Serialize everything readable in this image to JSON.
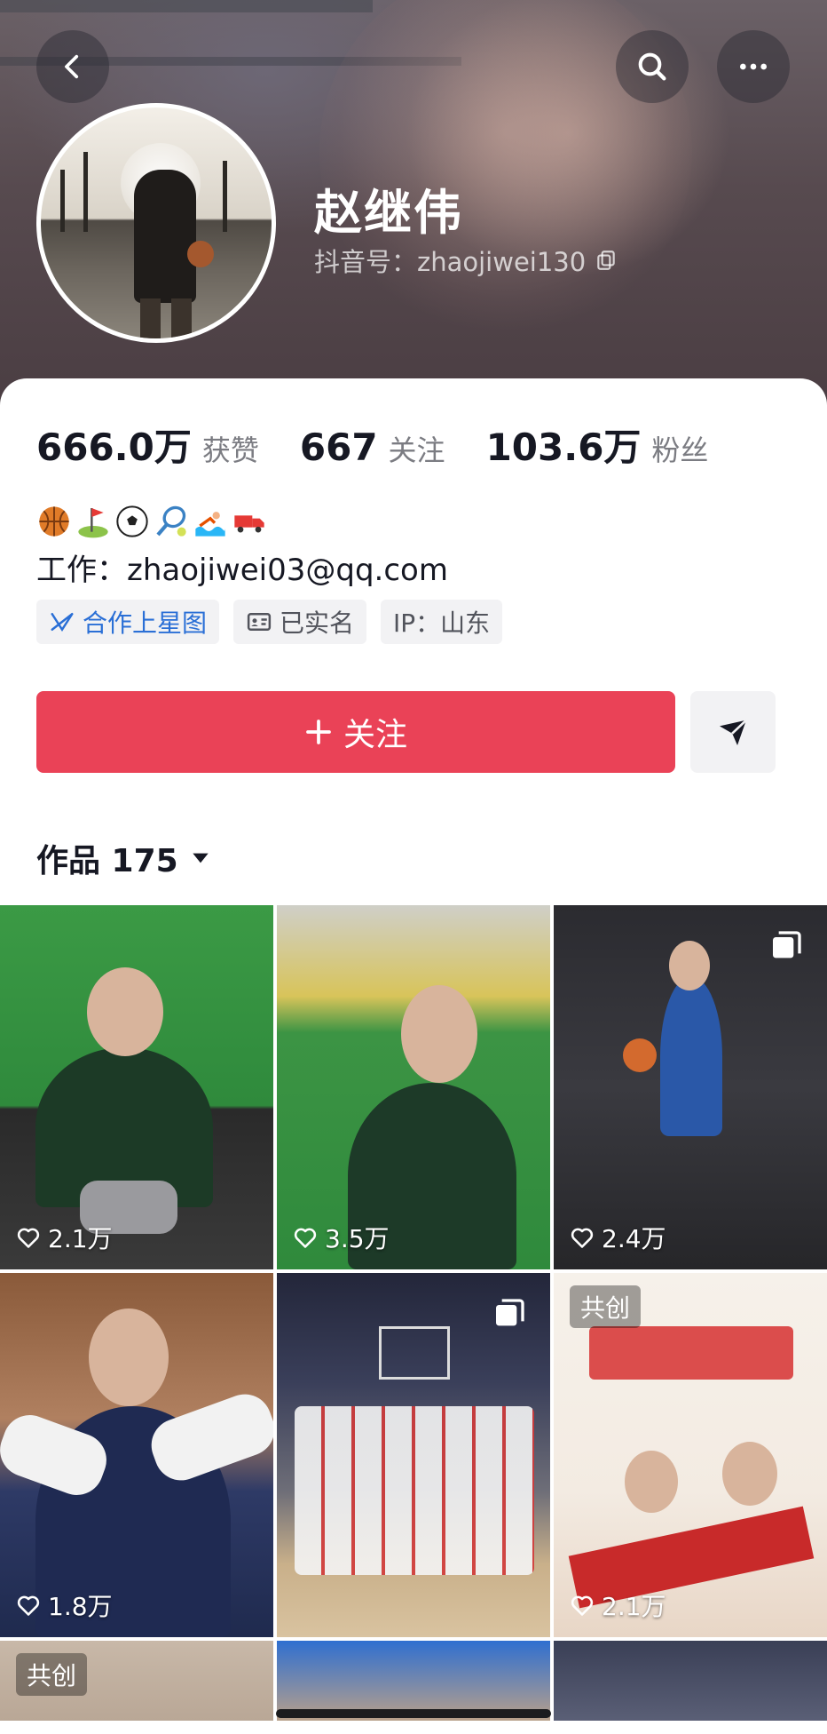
{
  "profile": {
    "name": "赵继伟",
    "douyin_id": "抖音号：zhaojiwei130"
  },
  "stats": [
    {
      "value": "666.0万",
      "label": "获赞"
    },
    {
      "value": "667",
      "label": "关注"
    },
    {
      "value": "103.6万",
      "label": "粉丝"
    }
  ],
  "bio": {
    "emojis": [
      "basketball",
      "golf",
      "soccer",
      "tennis",
      "swimming",
      "truck"
    ],
    "work": "工作：zhaojiwei03@qq.com"
  },
  "tags": [
    {
      "label": "合作上星图",
      "icon": "star-map-icon"
    },
    {
      "label": "已实名",
      "icon": "id-card-icon"
    },
    {
      "label": "IP：山东"
    }
  ],
  "actions": {
    "follow_label": "关注",
    "share_icon": "send-icon"
  },
  "works": {
    "title": "作品 175"
  },
  "grid": [
    {
      "likes": "2.1万"
    },
    {
      "likes": "3.5万"
    },
    {
      "likes": "2.4万",
      "multi": true
    },
    {
      "likes": "1.8万"
    },
    {
      "likes": "",
      "multi": true
    },
    {
      "likes": "2.1万",
      "badge": "共创"
    },
    {
      "badge": "共创"
    },
    {},
    {}
  ],
  "colors": {
    "accent": "#ea4257",
    "link_blue": "#2a6fd6",
    "secondary_text": "#7b7c82"
  }
}
